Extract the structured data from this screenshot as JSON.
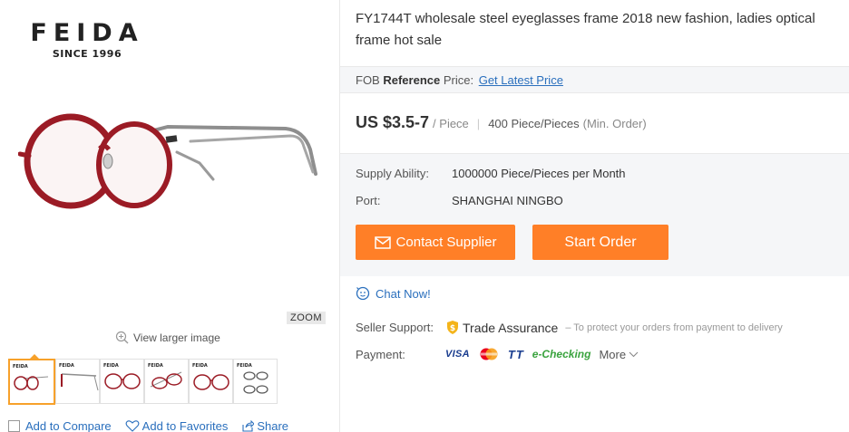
{
  "brand": {
    "name": "FEIDA",
    "tagline": "SINCE 1996"
  },
  "gallery": {
    "zoom_label": "ZOOM",
    "view_larger": "View larger image",
    "thumbnail_count": 6,
    "selected_thumbnail": 1
  },
  "product_actions": {
    "compare": "Add to Compare",
    "favorites": "Add to Favorites",
    "share": "Share"
  },
  "product": {
    "title": "FY1744T wholesale steel eyeglasses frame 2018 new fashion, ladies optical frame hot sale",
    "fob_prefix": "FOB",
    "fob_reference": "Reference",
    "fob_price_label": "Price:",
    "fob_link": "Get Latest Price",
    "price": "US $3.5-7",
    "price_unit": "/ Piece",
    "separator": "|",
    "moq": "400 Piece/Pieces",
    "moq_note": "(Min. Order)"
  },
  "details": {
    "supply_label": "Supply Ability:",
    "supply_value": "1000000 Piece/Pieces per Month",
    "port_label": "Port:",
    "port_value": "SHANGHAI NINGBO"
  },
  "buttons": {
    "contact": "Contact Supplier",
    "order": "Start Order"
  },
  "chat": {
    "label": "Chat Now!"
  },
  "seller": {
    "support_label": "Seller Support:",
    "trade_assurance": "Trade Assurance",
    "ta_note": "– To protect your orders from payment to delivery"
  },
  "payment": {
    "label": "Payment:",
    "visa": "VISA",
    "tt": "TT",
    "echecking": "e-Checking",
    "more": "More"
  },
  "colors": {
    "accent": "#ff7f27",
    "link": "#2a6fbd",
    "frame_red": "#9b1b25",
    "selected_border": "#f7a12b"
  }
}
